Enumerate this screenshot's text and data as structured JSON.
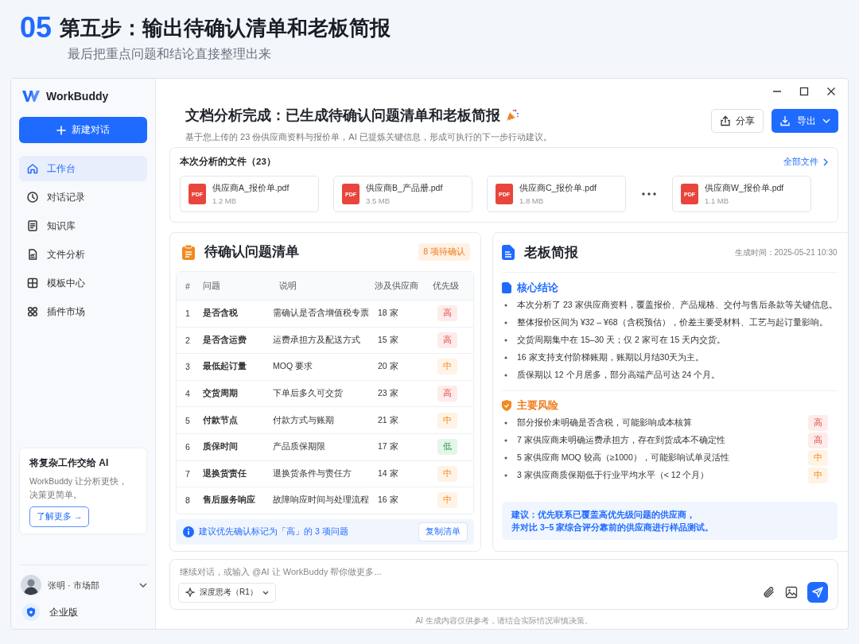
{
  "header": {
    "step": "05",
    "title": "第五步：输出待确认清单和老板简报",
    "subtitle": "最后把重点问题和结论直接整理出来"
  },
  "sidebar": {
    "brand": "WorkBuddy",
    "new_chat": "新建对话",
    "items": [
      {
        "label": "工作台",
        "kind": "home",
        "selected": true
      },
      {
        "label": "对话记录",
        "kind": "history",
        "selected": false
      },
      {
        "label": "知识库",
        "kind": "book",
        "selected": false
      },
      {
        "label": "文件分析",
        "kind": "file",
        "selected": false
      },
      {
        "label": "模板中心",
        "kind": "template",
        "selected": false
      },
      {
        "label": "插件市场",
        "kind": "plugins",
        "selected": false
      }
    ],
    "promo": {
      "title": "将复杂工作交给 AI",
      "text": "WorkBuddy 让分析更快，决策更简单。",
      "button": "了解更多 →"
    },
    "user": {
      "name": "张明 · 市场部"
    },
    "plan": "企业版"
  },
  "main": {
    "title": "文档分析完成：已生成待确认问题清单和老板简报",
    "subtitle": "基于您上传的 23 份供应商资料与报价单，AI 已提炼关键信息，形成可执行的下一步行动建议。",
    "share": "分享",
    "export": "导出",
    "files": {
      "title": "本次分析的文件（23）",
      "link": "全部文件",
      "items": [
        {
          "kind": "file",
          "type": "PDF",
          "name": "供应商A_报价单.pdf",
          "size": "1.2 MB"
        },
        {
          "kind": "file",
          "type": "PDF",
          "name": "供应商B_产品册.pdf",
          "size": "3.5 MB"
        },
        {
          "kind": "file",
          "type": "PDF",
          "name": "供应商C_报价单.pdf",
          "size": "1.8 MB"
        },
        {
          "kind": "more"
        },
        {
          "kind": "file",
          "type": "PDF",
          "name": "供应商W_报价单.pdf",
          "size": "1.1 MB"
        }
      ]
    },
    "issues": {
      "title": "待确认问题清单",
      "badge": "8 项待确认",
      "columns": [
        "#",
        "问题",
        "说明",
        "涉及供应商",
        "优先级"
      ],
      "rows": [
        {
          "no": "1",
          "issue": "是否含税",
          "desc": "需确认是否含增值税专票",
          "suppliers": "18 家",
          "priority": "高",
          "kind": "high"
        },
        {
          "no": "2",
          "issue": "是否含运费",
          "desc": "运费承担方及配送方式",
          "suppliers": "15 家",
          "priority": "高",
          "kind": "high"
        },
        {
          "no": "3",
          "issue": "最低起订量",
          "desc": "MOQ 要求",
          "suppliers": "20 家",
          "priority": "中",
          "kind": "mid"
        },
        {
          "no": "4",
          "issue": "交货周期",
          "desc": "下单后多久可交货",
          "suppliers": "23 家",
          "priority": "高",
          "kind": "high"
        },
        {
          "no": "5",
          "issue": "付款节点",
          "desc": "付款方式与账期",
          "suppliers": "21 家",
          "priority": "中",
          "kind": "mid"
        },
        {
          "no": "6",
          "issue": "质保时间",
          "desc": "产品质保期限",
          "suppliers": "17 家",
          "priority": "低",
          "kind": "low"
        },
        {
          "no": "7",
          "issue": "退换货责任",
          "desc": "退换货条件与责任方",
          "suppliers": "14 家",
          "priority": "中",
          "kind": "mid"
        },
        {
          "no": "8",
          "issue": "售后服务响应",
          "desc": "故障响应时间与处理流程",
          "suppliers": "16 家",
          "priority": "中",
          "kind": "mid"
        }
      ],
      "note": "建议优先确认标记为「高」的 3 项问题",
      "copy": "复制清单"
    },
    "brief": {
      "title": "老板简报",
      "time": "生成时间：2025-05-21 10:30",
      "sections": [
        {
          "kind": "conclusion",
          "title": "核心结论",
          "items": [
            {
              "text": "本次分析了 23 家供应商资料，覆盖报价、产品规格、交付与售后条款等关键信息。"
            },
            {
              "text": "整体报价区间为 ¥32 – ¥68（含税预估），价差主要受材料、工艺与起订量影响。"
            },
            {
              "text": "交货周期集中在 15–30 天；仅 2 家可在 15 天内交货。"
            },
            {
              "text": "16 家支持支付阶梯账期，账期以月结30天为主。"
            },
            {
              "text": "质保期以 12 个月居多，部分高端产品可达  24 个月。"
            }
          ]
        },
        {
          "kind": "risk",
          "title": "主要风险",
          "items": [
            {
              "text": "部分报价未明确是否含税，可能影响成本核算",
              "priority": "高",
              "kind": "high"
            },
            {
              "text": "7 家供应商未明确运费承担方，存在到货成本不确定性",
              "priority": "高",
              "kind": "high"
            },
            {
              "text": "5 家供应商 MOQ 较高（≥1000），可能影响试单灵活性",
              "priority": "中",
              "kind": "mid"
            },
            {
              "text": "3 家供应商质保期低于行业平均水平（< 12 个月）",
              "priority": "中",
              "kind": "mid"
            }
          ]
        }
      ],
      "advice": [
        "建议：优先联系已覆盖高优先级问题的供应商，",
        "并对比 3–5 家综合评分靠前的供应商进行样品测试。"
      ]
    },
    "composer": {
      "placeholder": "继续对话，或输入 @AI 让 WorkBuddy 帮你做更多...",
      "model": "深度思考（R1）"
    },
    "disclaimer": "AI 生成内容仅供参考，请结合实际情况审慎决策。"
  }
}
